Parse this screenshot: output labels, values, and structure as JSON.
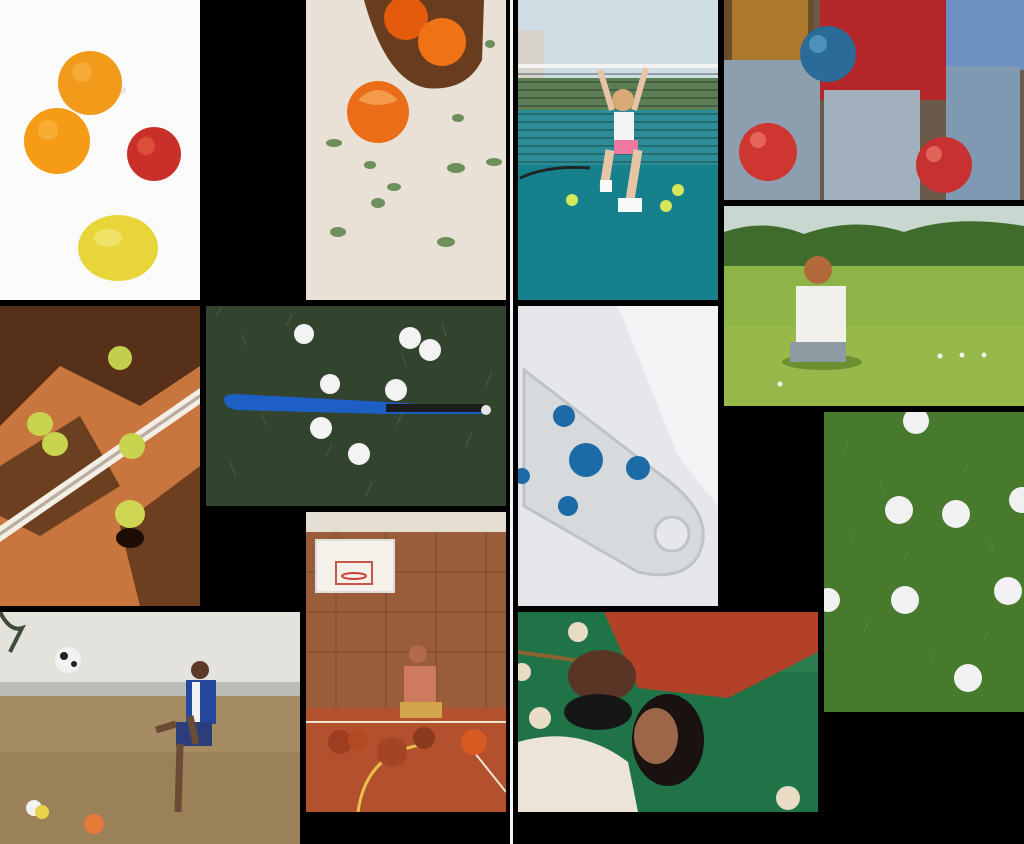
{
  "collage": {
    "background": "#000000",
    "divider_color": "#f4f4f4",
    "photos": [
      {
        "subject": "oranges-apple-lemon"
      },
      {
        "subject": "tangerines-bowl"
      },
      {
        "subject": "tennis-player-court"
      },
      {
        "subject": "bowling-balls-jeans"
      },
      {
        "subject": "tennis-balls-shadow-court"
      },
      {
        "subject": "bat-wiffle-balls-grass"
      },
      {
        "subject": "blue-balls-clear-tray"
      },
      {
        "subject": "woman-sitting-field"
      },
      {
        "subject": "golf-balls-grass"
      },
      {
        "subject": "basketball-gym-woman"
      },
      {
        "subject": "beach-soccer-player"
      },
      {
        "subject": "billiards-couple-lying"
      }
    ]
  }
}
